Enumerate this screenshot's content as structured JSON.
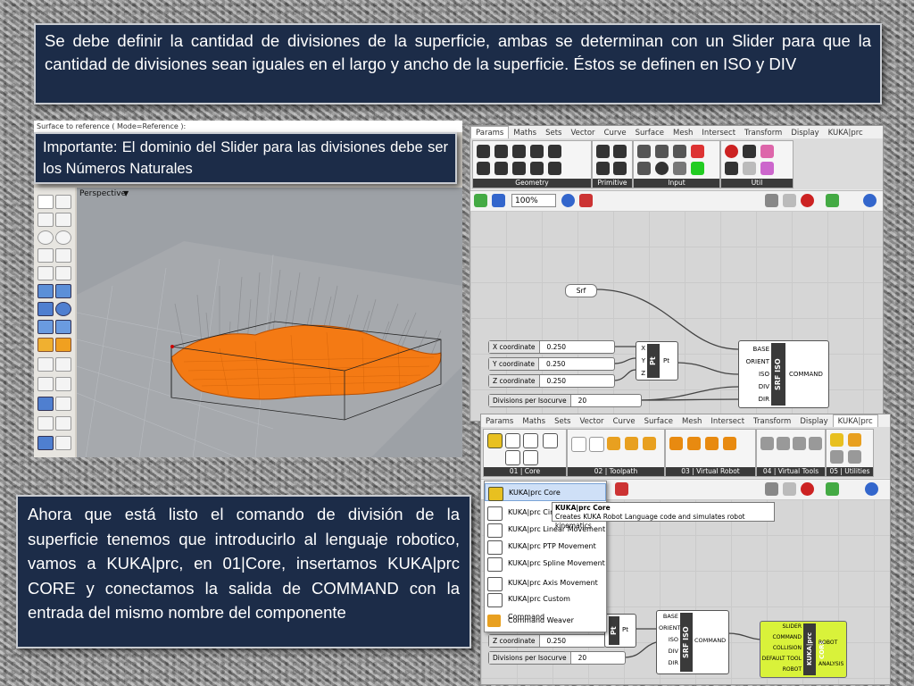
{
  "top_text": "Se debe definir la cantidad de divisiones de la superficie, ambas se determinan con un Slider para que la cantidad de divisiones sean iguales en el largo y ancho de la superficie. Éstos se definen en ISO y DIV",
  "small_text": "Importante: El dominio del Slider para las divisiones debe ser los Números Naturales",
  "bottom_text": "Ahora que está listo el comando de división de la superficie tenemos que introducirlo al lenguaje robotico, vamos a KUKA|prc, en 01|Core, insertamos KUKA|prc CORE y conectamos la salida de COMMAND con la entrada del mismo nombre del componente",
  "rhino": {
    "command_line": "Surface to reference ( Mode=Reference ):",
    "viewport_label": "Perspective"
  },
  "gh_top": {
    "tabs": [
      "Params",
      "Maths",
      "Sets",
      "Vector",
      "Curve",
      "Surface",
      "Mesh",
      "Intersect",
      "Transform",
      "Display",
      "KUKA|prc"
    ],
    "active_tab": "Params",
    "groups": [
      "Geometry",
      "Primitive",
      "Input",
      "Util"
    ],
    "zoom": "100%",
    "srf_label": "Srf",
    "sliders": [
      {
        "name": "X coordinate",
        "value": "0.250"
      },
      {
        "name": "Y coordinate",
        "value": "0.250"
      },
      {
        "name": "Z coordinate",
        "value": "0.250"
      },
      {
        "name": "Divisions per Isocurve",
        "value": "20"
      }
    ],
    "pt": {
      "inputs": [
        "X",
        "Y",
        "Z"
      ],
      "core": "Pt",
      "output": "Pt"
    },
    "srf_iso": {
      "inputs": [
        "BASE",
        "ORIENT",
        "ISO",
        "DIV",
        "DIR"
      ],
      "core": "SRF ISO",
      "output": "COMMAND"
    }
  },
  "gh_bottom": {
    "tabs": [
      "Params",
      "Maths",
      "Sets",
      "Vector",
      "Curve",
      "Surface",
      "Mesh",
      "Intersect",
      "Transform",
      "Display",
      "KUKA|prc"
    ],
    "active_tab": "KUKA|prc",
    "groups": [
      "01 | Core",
      "02 | Toolpath",
      "03 | Virtual Robot",
      "04 | Virtual Tools",
      "05 | Utilities"
    ],
    "sliders": [
      {
        "name": "Z coordinate",
        "value": "0.250"
      },
      {
        "name": "Divisions per Isocurve",
        "value": "20"
      }
    ],
    "pt": {
      "core": "Pt",
      "output": "Pt"
    },
    "srf_iso": {
      "inputs": [
        "BASE",
        "ORIENT",
        "ISO",
        "DIV",
        "DIR"
      ],
      "core": "SRF ISO",
      "output": "COMMAND"
    },
    "kuka_core": {
      "inputs": [
        "SLIDER",
        "COMMAND",
        "COLLISION",
        "DEFAULT TOOL",
        "ROBOT"
      ],
      "core": "KUKA|prc CORE",
      "outputs": [
        "ROBOT",
        "ANALYSIS"
      ]
    }
  },
  "menu": {
    "items": [
      {
        "icon": "core-icon",
        "label": "KUKA|prc Core"
      },
      {
        "icon": "cir-icon",
        "label": "KUKA|prc Circu"
      },
      {
        "icon": "lin-icon",
        "label": "KUKA|prc Linear Movement"
      },
      {
        "icon": "ptp-icon",
        "label": "KUKA|prc PTP Movement"
      },
      {
        "icon": "spline-icon",
        "label": "KUKA|prc Spline Movement"
      },
      {
        "icon": "axis-icon",
        "label": "KUKA|prc Axis Movement"
      },
      {
        "icon": "krl-icon",
        "label": "KUKA|prc Custom Command"
      },
      {
        "icon": "weaver-icon",
        "label": "Command Weaver"
      }
    ]
  },
  "tooltip": {
    "title": "KUKA|prc Core",
    "description": "Creates KUKA Robot Language code and simulates robot kinematics"
  },
  "colors": {
    "text_box": "#1c2c48",
    "surface": "#f47a14",
    "kuka_yellow": "#d9f23a"
  }
}
